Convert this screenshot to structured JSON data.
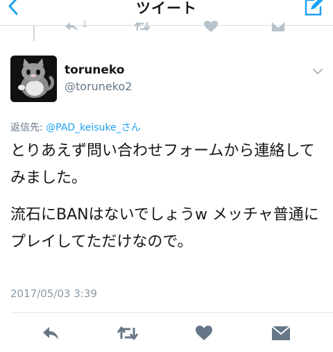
{
  "nav": {
    "title": "ツイート",
    "back_icon": "chevron-left-icon",
    "compose_icon": "compose-icon",
    "accent": "#1da1f2"
  },
  "author": {
    "display_name": "toruneko",
    "username": "@toruneko2"
  },
  "reply": {
    "prefix": "返信先: ",
    "mention": "@PAD_keisuke_さん"
  },
  "tweet": {
    "paragraph1": "とりあえず問い合わせフォームから連絡してみました。",
    "paragraph2": "流石にBANはないでしょうw メッチャ普通にプレイしてただけなので。",
    "timestamp": "2017/05/03 3:39"
  },
  "prev_tweet": {
    "reply_count": "1"
  },
  "actions": {
    "reply": "reply-icon",
    "retweet": "retweet-icon",
    "like": "heart-icon",
    "dm": "envelope-icon"
  },
  "colors": {
    "text": "#14171a",
    "secondary": "#657786",
    "icon": "#657786",
    "link": "#1da1f2"
  }
}
